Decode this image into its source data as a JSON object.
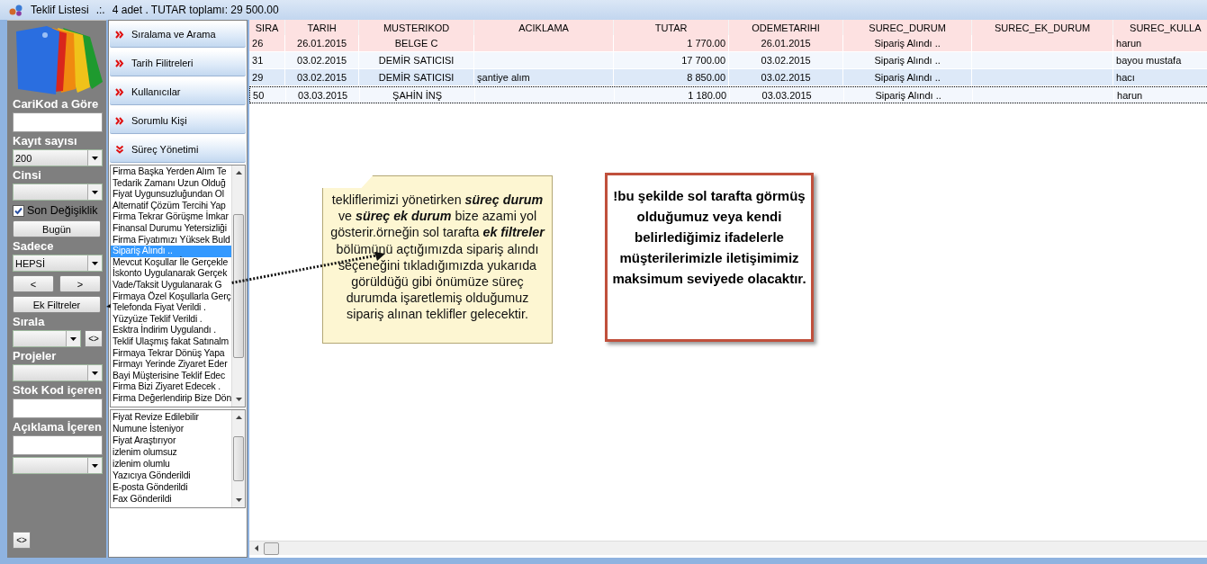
{
  "window": {
    "title": "Teklif Listesi",
    "separator": ".:.",
    "summary": "4 adet . TUTAR toplamı: 29 500.00"
  },
  "controls": [
    {
      "kind": "label",
      "text": "CariKod a Göre"
    },
    {
      "kind": "input"
    },
    {
      "kind": "label",
      "text": "Kayıt sayısı"
    },
    {
      "kind": "combo",
      "value": "200"
    },
    {
      "kind": "label",
      "text": "Cinsi"
    },
    {
      "kind": "combo"
    },
    {
      "kind": "checkbox",
      "label": "Son Değişiklik",
      "checked": true
    },
    {
      "kind": "button",
      "label": "Bugün"
    },
    {
      "kind": "label",
      "text": "Sadece"
    },
    {
      "kind": "combo",
      "value": "HEPSİ"
    },
    {
      "kind": "nav",
      "prev": "<",
      "next": ">"
    },
    {
      "kind": "button",
      "label": "Ek Filtreler"
    },
    {
      "kind": "label",
      "text": "Sırala"
    },
    {
      "kind": "combo_button",
      "button": "<>"
    },
    {
      "kind": "label",
      "text": "Projeler"
    },
    {
      "kind": "combo"
    },
    {
      "kind": "label",
      "text": "Stok Kod içeren"
    },
    {
      "kind": "input"
    },
    {
      "kind": "label",
      "text": "Açıklama İçeren"
    },
    {
      "kind": "input"
    },
    {
      "kind": "combo"
    }
  ],
  "bottom_button": "<>",
  "sections": [
    {
      "label": "Sıralama ve Arama",
      "expanded": false
    },
    {
      "label": "Tarih Filitreleri",
      "expanded": false
    },
    {
      "label": "Kullanıcılar",
      "expanded": false
    },
    {
      "label": "Sorumlu Kişi",
      "expanded": false
    },
    {
      "label": "Süreç Yönetimi",
      "expanded": true
    }
  ],
  "status_list": [
    {
      "label": "Firma Başka Yerden Alım Te",
      "selected": false
    },
    {
      "label": "Tedarik Zamanı Uzun Olduğ",
      "selected": false
    },
    {
      "label": "Fiyat Uygunsuzluğundan Ol",
      "selected": false
    },
    {
      "label": "Alternatif Çözüm Tercihi Yap",
      "selected": false
    },
    {
      "label": "Firma Tekrar Görüşme İmkar",
      "selected": false
    },
    {
      "label": "Finansal Durumu Yetersizliği",
      "selected": false
    },
    {
      "label": "Firma Fiyatımızı Yüksek Buld",
      "selected": false
    },
    {
      "label": "Sipariş Alındı ..",
      "selected": true
    },
    {
      "label": "Mevcut Koşullar İle Gerçekle",
      "selected": false
    },
    {
      "label": "İskonto Uygulanarak Gerçek",
      "selected": false
    },
    {
      "label": "Vade/Taksit Uygulanarak G",
      "selected": false
    },
    {
      "label": "Firmaya Özel Koşullarla Gerç",
      "selected": false
    },
    {
      "label": "Telefonda Fiyat Verildi .",
      "selected": false
    },
    {
      "label": "Yüzyüze Teklif Verildi .",
      "selected": false
    },
    {
      "label": "Esktra İndirim Uygulandı .",
      "selected": false
    },
    {
      "label": "Teklif Ulaşmış fakat Satınalm",
      "selected": false
    },
    {
      "label": "Firmaya Tekrar Dönüş Yapa",
      "selected": false
    },
    {
      "label": "Firmayı Yerinde Ziyaret Eder",
      "selected": false
    },
    {
      "label": "Bayi Müşterisine Teklif Edec",
      "selected": false
    },
    {
      "label": "Firma Bizi Ziyaret Edecek .",
      "selected": false
    },
    {
      "label": "Firma Değerlendirip Bize Dön",
      "selected": false
    }
  ],
  "extra_status_list": [
    {
      "label": "Fiyat Revize Edilebilir",
      "selected": false
    },
    {
      "label": "Numune İsteniyor",
      "selected": false
    },
    {
      "label": "Fiyat Araştırıyor",
      "selected": false
    },
    {
      "label": "izlenim olumsuz",
      "selected": false
    },
    {
      "label": "izlenim olumlu",
      "selected": false
    },
    {
      "label": "Yazıcıya Gönderildi",
      "selected": false
    },
    {
      "label": "E-posta Gönderildi",
      "selected": false
    },
    {
      "label": "Fax Gönderildi",
      "selected": false
    }
  ],
  "table": {
    "columns": [
      {
        "label": "SIRA"
      },
      {
        "label": "TARIH"
      },
      {
        "label": "MUSTERIKOD"
      },
      {
        "label": "ACIKLAMA"
      },
      {
        "label": "TUTAR"
      },
      {
        "label": "ODEMETARIHI"
      },
      {
        "label": "SUREC_DURUM"
      },
      {
        "label": "SUREC_EK_DURUM"
      },
      {
        "label": "SUREC_KULLA"
      }
    ],
    "rows": [
      {
        "color": "#fde1e1",
        "focused": false,
        "cells": [
          "26",
          "26.01.2015",
          "BELGE C",
          "",
          "1 770.00",
          "26.01.2015",
          "Sipariş Alındı ..",
          "",
          "harun"
        ]
      },
      {
        "color": "#f3f7fd",
        "focused": false,
        "cells": [
          "31",
          "03.02.2015",
          "DEMİR SATICISI",
          "",
          "17 700.00",
          "03.02.2015",
          "Sipariş Alındı ..",
          "",
          "bayou mustafa"
        ]
      },
      {
        "color": "#dde9f8",
        "focused": false,
        "cells": [
          "29",
          "03.02.2015",
          "DEMİR SATICISI",
          "şantiye alım",
          "8 850.00",
          "03.02.2015",
          "Sipariş Alındı ..",
          "",
          "hacı"
        ]
      },
      {
        "color": "#f3f7fd",
        "focused": true,
        "cells": [
          "50",
          "03.03.2015",
          "ŞAHİN İNŞ",
          "",
          "1 180.00",
          "03.03.2015",
          "Sipariş Alındı ..",
          "",
          "harun"
        ]
      }
    ]
  },
  "note": {
    "text": "tekliflerimizi yönetirken **süreç durum** ve **süreç ek durum** bize azami yol gösterir.örneğin sol tarafta **ek filtreler** bölümünü açtığımızda sipariş alındı seçeneğini tıkladığımızda yukarıda görüldüğü gibi önümüze süreç durumda işaretlemiş olduğumuz sipariş alınan teklifler gelecektir."
  },
  "callout": {
    "text": "!bu şekilde sol tarafta görmüş olduğumuz veya kendi belirlediğimiz ifadelerle müşterilerimizle iletişimimiz maksimum seviyede olacaktır."
  }
}
